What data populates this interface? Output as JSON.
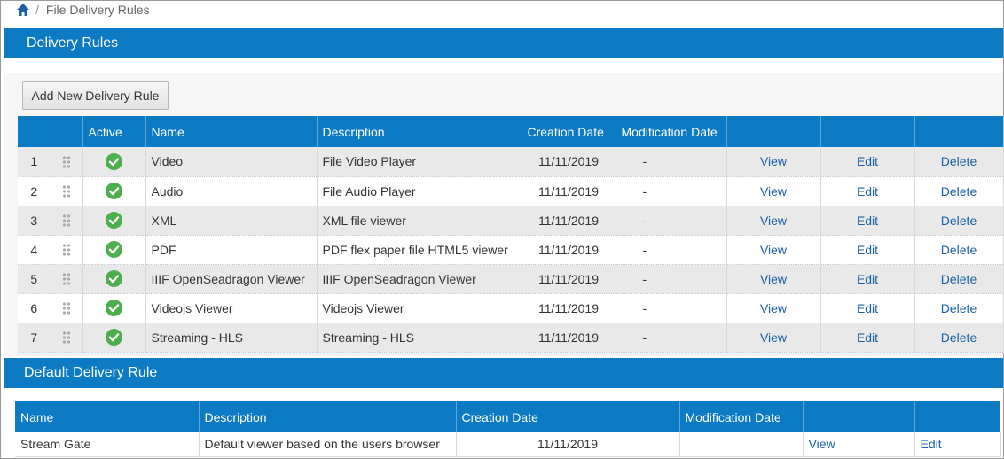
{
  "breadcrumb": {
    "separator": "/",
    "current": "File Delivery Rules"
  },
  "delivery_rules": {
    "title": "Delivery Rules",
    "add_button": "Add New Delivery Rule",
    "columns": [
      "",
      "",
      "Active",
      "Name",
      "Description",
      "Creation Date",
      "Modification Date",
      "",
      "",
      ""
    ],
    "rows": [
      {
        "index": "1",
        "name": "Video",
        "description": "File Video Player",
        "creation_date": "11/11/2019",
        "modification_date": "-",
        "view": "View",
        "edit": "Edit",
        "delete": "Delete"
      },
      {
        "index": "2",
        "name": "Audio",
        "description": "File Audio Player",
        "creation_date": "11/11/2019",
        "modification_date": "-",
        "view": "View",
        "edit": "Edit",
        "delete": "Delete"
      },
      {
        "index": "3",
        "name": "XML",
        "description": "XML file viewer",
        "creation_date": "11/11/2019",
        "modification_date": "-",
        "view": "View",
        "edit": "Edit",
        "delete": "Delete"
      },
      {
        "index": "4",
        "name": "PDF",
        "description": "PDF flex paper file HTML5 viewer",
        "creation_date": "11/11/2019",
        "modification_date": "-",
        "view": "View",
        "edit": "Edit",
        "delete": "Delete"
      },
      {
        "index": "5",
        "name": "IIIF OpenSeadragon Viewer",
        "description": "IIIF OpenSeadragon Viewer",
        "creation_date": "11/11/2019",
        "modification_date": "-",
        "view": "View",
        "edit": "Edit",
        "delete": "Delete"
      },
      {
        "index": "6",
        "name": "Videojs Viewer",
        "description": "Videojs Viewer",
        "creation_date": "11/11/2019",
        "modification_date": "-",
        "view": "View",
        "edit": "Edit",
        "delete": "Delete"
      },
      {
        "index": "7",
        "name": "Streaming - HLS",
        "description": "Streaming - HLS",
        "creation_date": "11/11/2019",
        "modification_date": "-",
        "view": "View",
        "edit": "Edit",
        "delete": "Delete"
      }
    ]
  },
  "default_rule": {
    "title": "Default Delivery Rule",
    "columns": [
      "Name",
      "Description",
      "Creation Date",
      "Modification Date",
      "",
      ""
    ],
    "row": {
      "name": "Stream Gate",
      "description": "Default viewer based on the users browser",
      "creation_date": "11/11/2019",
      "modification_date": "",
      "view": "View",
      "edit": "Edit"
    }
  },
  "icons": {
    "home": "home-icon",
    "active": "check-circle-icon",
    "drag": "drag-handle-icon"
  },
  "colors": {
    "header_blue": "#0d7bc4",
    "link": "#1a5fa8",
    "active_green": "#4cae4c"
  }
}
